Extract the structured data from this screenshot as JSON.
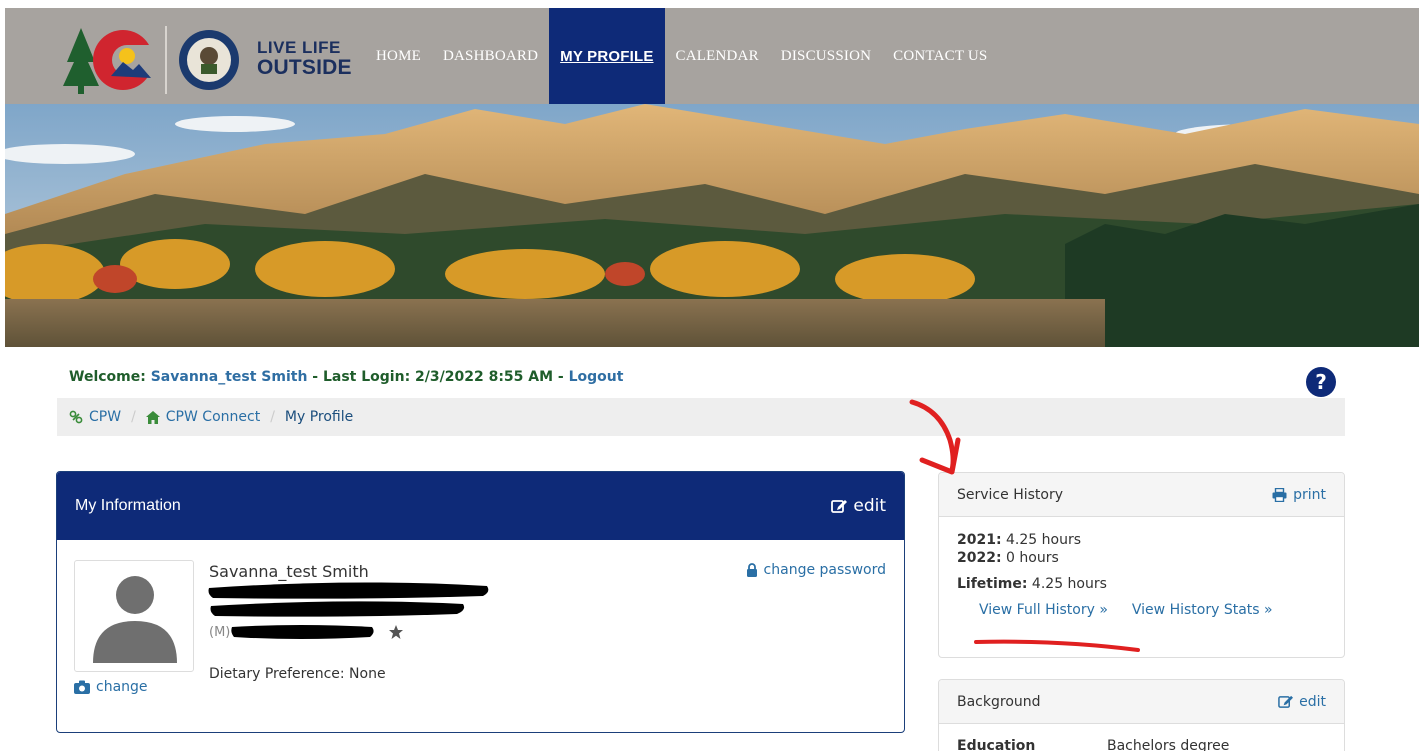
{
  "header": {
    "logo_line1": "LIVE LIFE",
    "logo_line2": "OUTSIDE",
    "nav": [
      {
        "label": "HOME",
        "active": false
      },
      {
        "label": "DASHBOARD",
        "active": false
      },
      {
        "label": "MY PROFILE",
        "active": true
      },
      {
        "label": "CALENDAR",
        "active": false
      },
      {
        "label": "DISCUSSION",
        "active": false
      },
      {
        "label": "CONTACT US",
        "active": false
      }
    ]
  },
  "welcome": {
    "prefix": "Welcome: ",
    "user": "Savanna_test Smith",
    "last_login": " - Last Login: 2/3/2022 8:55 AM - ",
    "logout": "Logout"
  },
  "breadcrumb": [
    "CPW",
    "CPW Connect",
    "My Profile"
  ],
  "my_information": {
    "title": "My Information",
    "edit": "edit",
    "name": "Savanna_test Smith",
    "change_password": "change password",
    "phone_prefix": "(M)",
    "dietary": "Dietary Preference: None",
    "change_photo": "change"
  },
  "service_history": {
    "title": "Service History",
    "print": "print",
    "years": [
      {
        "year": "2021:",
        "hours": " 4.25 hours"
      },
      {
        "year": "2022:",
        "hours": " 0 hours"
      }
    ],
    "lifetime_label": "Lifetime:",
    "lifetime_value": " 4.25 hours",
    "view_full_history": "View Full History »",
    "view_history_stats": "View History Stats »"
  },
  "background": {
    "title": "Background",
    "edit": "edit",
    "education_label": "Education",
    "education_value": "Bachelors degree"
  },
  "colors": {
    "nav_active": "#0e2a78",
    "header_bg": "#a7a39f",
    "link": "#2a6fa5",
    "welcome_green": "#1f5d2b",
    "annotation_red": "#e02020"
  }
}
